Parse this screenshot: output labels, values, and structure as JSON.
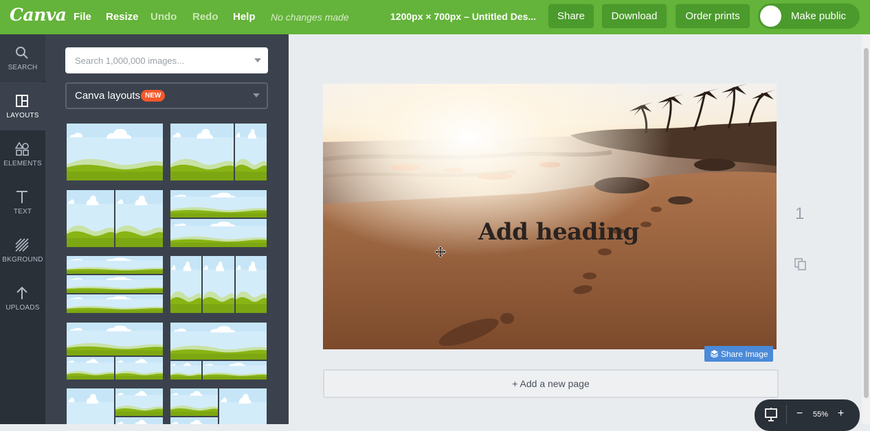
{
  "topbar": {
    "logo": "Canva",
    "menu": [
      "File",
      "Resize",
      "Undo",
      "Redo",
      "Help"
    ],
    "status": "No changes made",
    "doc_title": "1200px × 700px – Untitled Des...",
    "share_label": "Share",
    "download_label": "Download",
    "order_prints_label": "Order prints",
    "make_public_label": "Make public"
  },
  "rail": {
    "items": [
      {
        "label": "SEARCH",
        "icon": "search-icon"
      },
      {
        "label": "LAYOUTS",
        "icon": "layouts-icon"
      },
      {
        "label": "ELEMENTS",
        "icon": "elements-icon"
      },
      {
        "label": "TEXT",
        "icon": "text-icon"
      },
      {
        "label": "BKGROUND",
        "icon": "background-icon"
      },
      {
        "label": "UPLOADS",
        "icon": "upload-icon"
      }
    ]
  },
  "panel": {
    "search_placeholder": "Search 1,000,000 images...",
    "layout_select": "Canva layouts",
    "new_badge": "NEW"
  },
  "canvas": {
    "heading": "Add heading",
    "page_number": "1",
    "share_image_label": "Share Image",
    "add_page_label": "+ Add a new page"
  },
  "zoom": {
    "minus": "−",
    "value": "55%",
    "plus": "+"
  },
  "colors": {
    "topbar": "#64b33a",
    "button": "#4b9a2c",
    "rail": "#2a3038",
    "panel": "#3b424d",
    "accent_badge": "#f5582c",
    "share_image": "#4a8ad8"
  }
}
